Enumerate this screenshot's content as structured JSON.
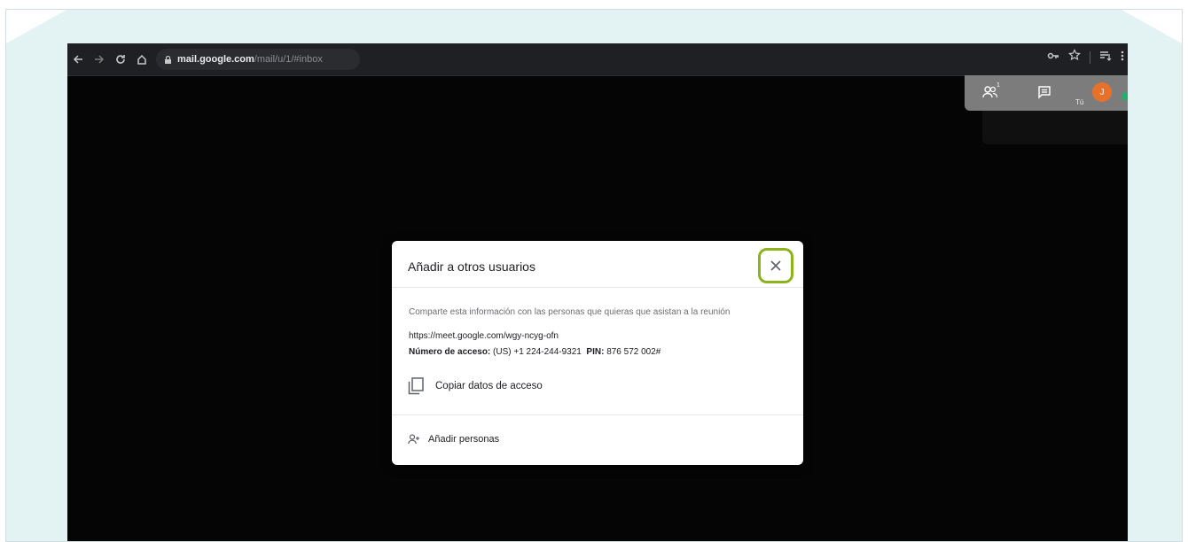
{
  "browser": {
    "url_host": "mail.google.com",
    "url_path": "/mail/u/1/#inbox",
    "toolbar_icons": [
      "back-arrow",
      "forward-arrow",
      "reload",
      "home",
      "lock",
      "key",
      "star",
      "playlist",
      "menu-dots"
    ]
  },
  "meet_panel": {
    "participant_count": "1",
    "self_label": "Tú",
    "avatar_initial": "J",
    "avatar_color": "#e8712a"
  },
  "dialog": {
    "title": "Añadir a otros usuarios",
    "description": "Comparte esta información con las personas que quieras que asistan a la reunión",
    "meeting_link": "https://meet.google.com/wgy-ncyg-ofn",
    "access_label": "Número de acceso:",
    "access_value": "(US) +1 224-244-9321",
    "pin_label": "PIN:",
    "pin_value": "876 572 002#",
    "copy_label": "Copiar datos de acceso",
    "add_people_label": "Añadir personas",
    "close_highlight_color": "#8db31b"
  }
}
